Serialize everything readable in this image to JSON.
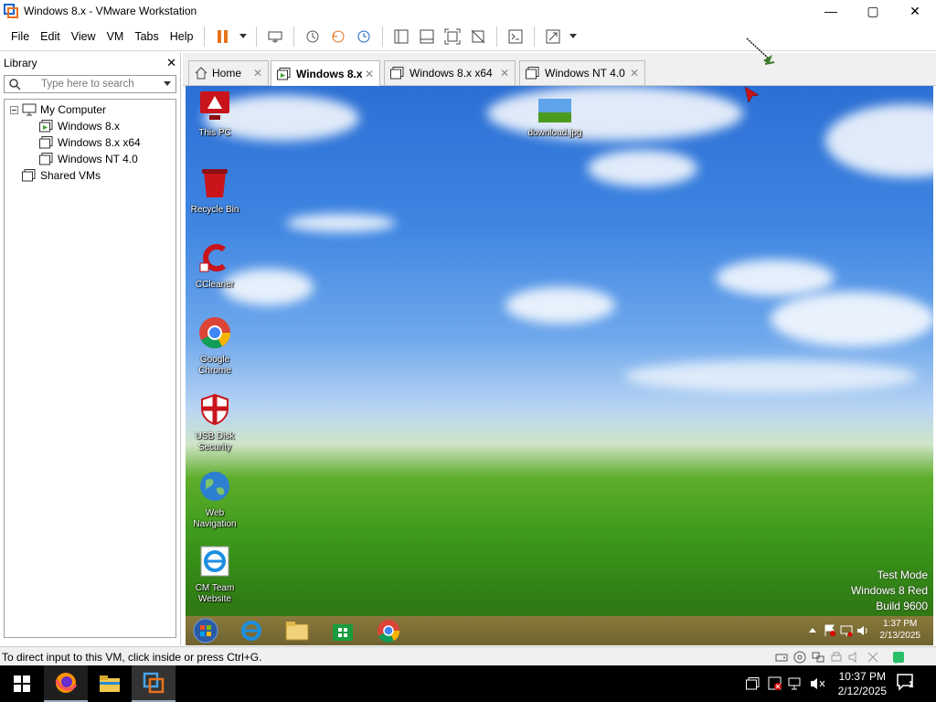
{
  "window": {
    "title": "Windows 8.x - VMware Workstation",
    "minimize": "—",
    "maximize": "▢",
    "close": "✕"
  },
  "menu": [
    "File",
    "Edit",
    "View",
    "VM",
    "Tabs",
    "Help"
  ],
  "library": {
    "title": "Library",
    "close": "✕",
    "search_placeholder": "Type here to search",
    "tree": {
      "root": "My Computer",
      "vms": [
        "Windows 8.x",
        "Windows 8.x x64",
        "Windows NT 4.0"
      ],
      "shared": "Shared VMs"
    }
  },
  "tabs": [
    {
      "label": "Home",
      "active": false
    },
    {
      "label": "Windows 8.x",
      "active": true
    },
    {
      "label": "Windows 8.x x64",
      "active": false
    },
    {
      "label": "Windows NT 4.0",
      "active": false
    }
  ],
  "vm": {
    "desktop_icons": [
      {
        "label": "This PC"
      },
      {
        "label": "Recycle Bin"
      },
      {
        "label": "CCleaner"
      },
      {
        "label": "Google Chrome"
      },
      {
        "label": "USB Disk Security"
      },
      {
        "label": "Web Navigation"
      },
      {
        "label": "CM Team Website"
      }
    ],
    "file_icon": "download.jpg",
    "watermark": [
      "Test Mode",
      "Windows 8 Red",
      "Build 9600"
    ],
    "clock": {
      "time": "1:37 PM",
      "date": "2/13/2025"
    }
  },
  "status": {
    "text": "To direct input to this VM, click inside or press Ctrl+G."
  },
  "host": {
    "clock": {
      "time": "10:37 PM",
      "date": "2/12/2025"
    },
    "notifications": "1"
  },
  "colors": {
    "pause": "#e8721b",
    "accent": "#1c63c9",
    "vm_taskbar": "#7a6b34"
  }
}
